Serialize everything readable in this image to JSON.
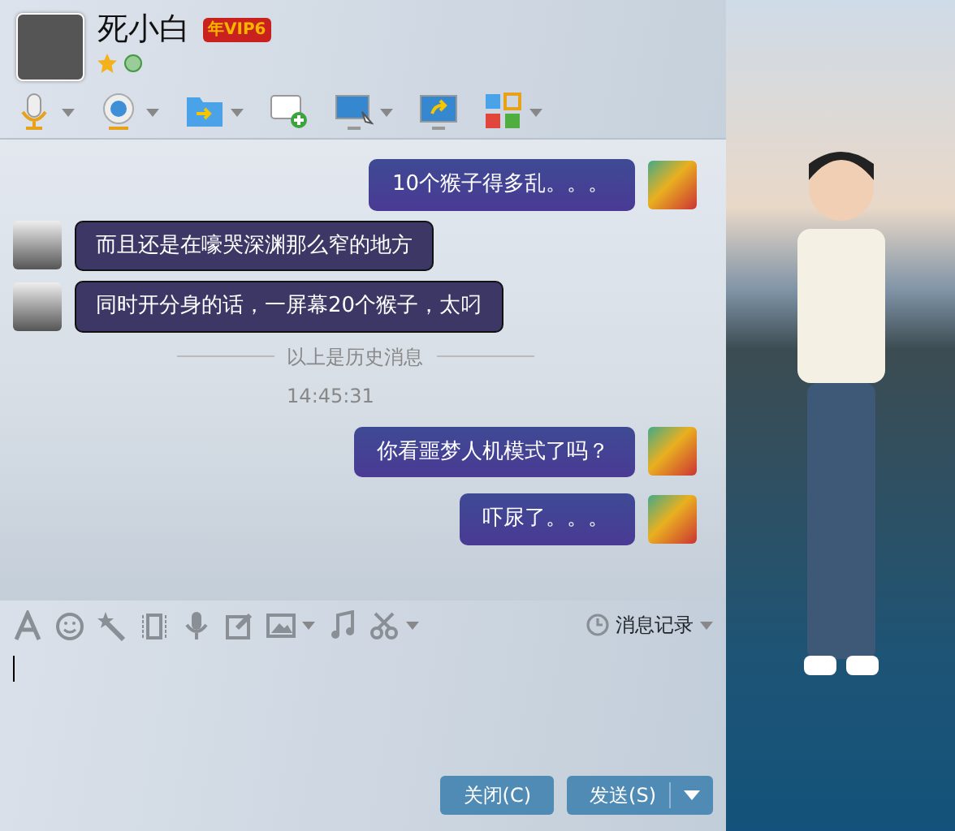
{
  "window": {
    "title": "死小白",
    "badge": "年VIP6"
  },
  "messages": [
    {
      "kind": "sent",
      "text": "10个猴子得多乱。。。"
    },
    {
      "kind": "received",
      "text": "而且还是在嚎哭深渊那么窄的地方"
    },
    {
      "kind": "received",
      "text": "同时开分身的话，一屏幕20个猴子，太叼"
    },
    {
      "kind": "divider",
      "text": "以上是历史消息"
    },
    {
      "kind": "time",
      "text": "14:45:31"
    },
    {
      "kind": "sent",
      "text": "你看噩梦人机模式了吗？"
    },
    {
      "kind": "sent",
      "text": "吓尿了。。。"
    }
  ],
  "history_button": "消息记录",
  "buttons": [
    {
      "label": "关闭(C)",
      "dropdown": false
    },
    {
      "label": "发送(S)",
      "dropdown": true
    }
  ]
}
